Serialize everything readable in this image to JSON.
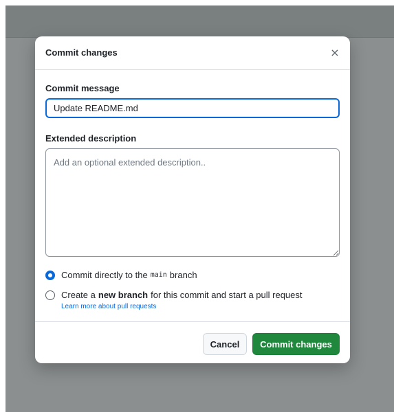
{
  "modal": {
    "title": "Commit changes",
    "close_icon": "close-icon",
    "close_glyph": "×"
  },
  "commit_message": {
    "label": "Commit message",
    "value": "Update README.md"
  },
  "extended_description": {
    "label": "Extended description",
    "placeholder": "Add an optional extended description..",
    "value": ""
  },
  "options": {
    "direct": {
      "selected": true,
      "prefix": "Commit directly to the",
      "branch": "main",
      "suffix": "branch"
    },
    "new_branch": {
      "selected": false,
      "prefix": "Create a",
      "emphasis": "new branch",
      "suffix": "for this commit and start a pull request",
      "link": "Learn more about pull requests"
    }
  },
  "footer": {
    "cancel_label": "Cancel",
    "commit_label": "Commit changes"
  },
  "colors": {
    "primary_green": "#1f883d",
    "accent_blue": "#0969da",
    "overlay_gray": "#8b8f8f"
  }
}
